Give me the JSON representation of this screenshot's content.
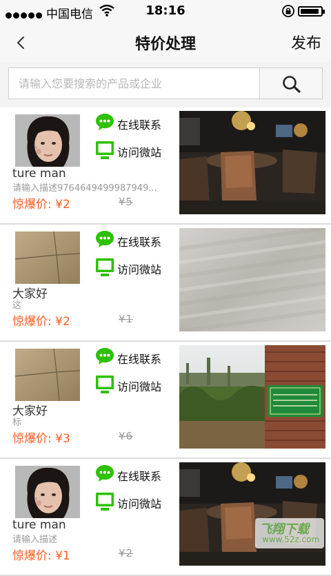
{
  "status_bar": {
    "carrier": "中国电信",
    "time": "18:16",
    "battery_level": 0.92
  },
  "nav": {
    "title": "特价处理",
    "publish_label": "发布"
  },
  "search": {
    "placeholder": "请输入您要搜索的产品或企业"
  },
  "actions": {
    "contact_label": "在线联系",
    "visit_label": "访问微站"
  },
  "items": [
    {
      "name": "ture man",
      "desc": "请输入描述9764649499987949...",
      "price": "惊爆价: ¥2",
      "old_price": "¥5",
      "avatar": "child-portrait",
      "photo": "restaurant-interior"
    },
    {
      "name": "大家好",
      "desc": "这",
      "price": "惊爆价: ¥2",
      "old_price": "¥1",
      "avatar": "tiled-floor",
      "photo": "blurred-floor"
    },
    {
      "name": "大家好",
      "desc": "标",
      "price": "惊爆价: ¥3",
      "old_price": "¥6",
      "avatar": "tiled-floor",
      "photo": "brick-wall-garden"
    },
    {
      "name": "ture man",
      "desc": "请输入描述",
      "price": "惊爆价: ¥1",
      "old_price": "¥2",
      "avatar": "child-portrait",
      "photo": "restaurant-interior"
    }
  ],
  "watermark": {
    "brand": "飞翔下载",
    "site": "www.52z.com"
  },
  "colors": {
    "price": "#ff5a1f",
    "wechat_green": "#2dc100",
    "divider": "#dcdcdc"
  }
}
